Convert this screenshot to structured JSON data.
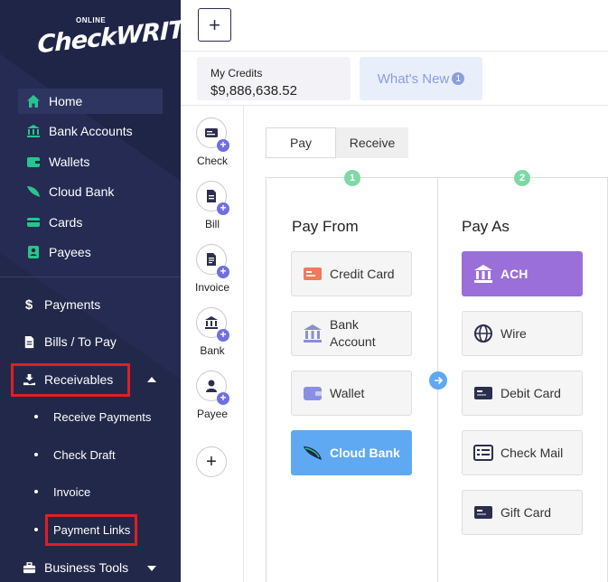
{
  "brand": {
    "online": "ONLINE",
    "name": "CheckWRITER"
  },
  "sidebar": {
    "items": [
      {
        "label": "Home",
        "icon": "home-icon",
        "active": true
      },
      {
        "label": "Bank Accounts",
        "icon": "bank-icon"
      },
      {
        "label": "Wallets",
        "icon": "wallet-icon"
      },
      {
        "label": "Cloud Bank",
        "icon": "cloud-bank-icon"
      },
      {
        "label": "Cards",
        "icon": "card-icon"
      },
      {
        "label": "Payees",
        "icon": "payees-icon"
      }
    ],
    "sections": [
      {
        "label": "Payments",
        "icon": "dollar-icon"
      },
      {
        "label": "Bills / To Pay",
        "icon": "document-icon"
      },
      {
        "label": "Receivables",
        "icon": "receive-hand-icon",
        "expanded": true
      },
      {
        "label": "Business Tools",
        "icon": "briefcase-icon",
        "expanded": false
      }
    ],
    "receivables_sub": [
      {
        "label": "Receive Payments"
      },
      {
        "label": "Check Draft"
      },
      {
        "label": "Invoice"
      },
      {
        "label": "Payment Links"
      }
    ],
    "accent_color": "#29c48c",
    "highlight_color": "#e01e26"
  },
  "topbar": {
    "add_label": "+"
  },
  "credits": {
    "label": "My Credits",
    "value": "$9,886,638.52"
  },
  "whats_new": {
    "label": "What's New",
    "badge": "1"
  },
  "quick_actions": [
    {
      "label": "Check",
      "icon": "check-icon"
    },
    {
      "label": "Bill",
      "icon": "bill-icon"
    },
    {
      "label": "Invoice",
      "icon": "invoice-icon"
    },
    {
      "label": "Bank",
      "icon": "bank-icon"
    },
    {
      "label": "Payee",
      "icon": "payee-icon"
    }
  ],
  "quick_add": "+",
  "tabs": {
    "pay": "Pay",
    "receive": "Receive"
  },
  "pay_from": {
    "step": "1",
    "title": "Pay From",
    "options": [
      {
        "label": "Credit Card",
        "icon": "credit-card-icon"
      },
      {
        "label_line1": "Bank",
        "label_line2": "Account",
        "icon": "bank-icon"
      },
      {
        "label": "Wallet",
        "icon": "wallet-icon"
      },
      {
        "label": "Cloud Bank",
        "icon": "cloud-bank-icon",
        "selected": true,
        "color": "#5fa9f3"
      }
    ]
  },
  "pay_as": {
    "step": "2",
    "title": "Pay As",
    "options": [
      {
        "label": "ACH",
        "icon": "bank-icon",
        "selected": true,
        "color": "#9a6fda"
      },
      {
        "label": "Wire",
        "icon": "globe-icon"
      },
      {
        "label": "Debit Card",
        "icon": "debit-card-icon"
      },
      {
        "label": "Check Mail",
        "icon": "check-mail-icon"
      },
      {
        "label": "Gift Card",
        "icon": "gift-card-icon"
      }
    ]
  }
}
